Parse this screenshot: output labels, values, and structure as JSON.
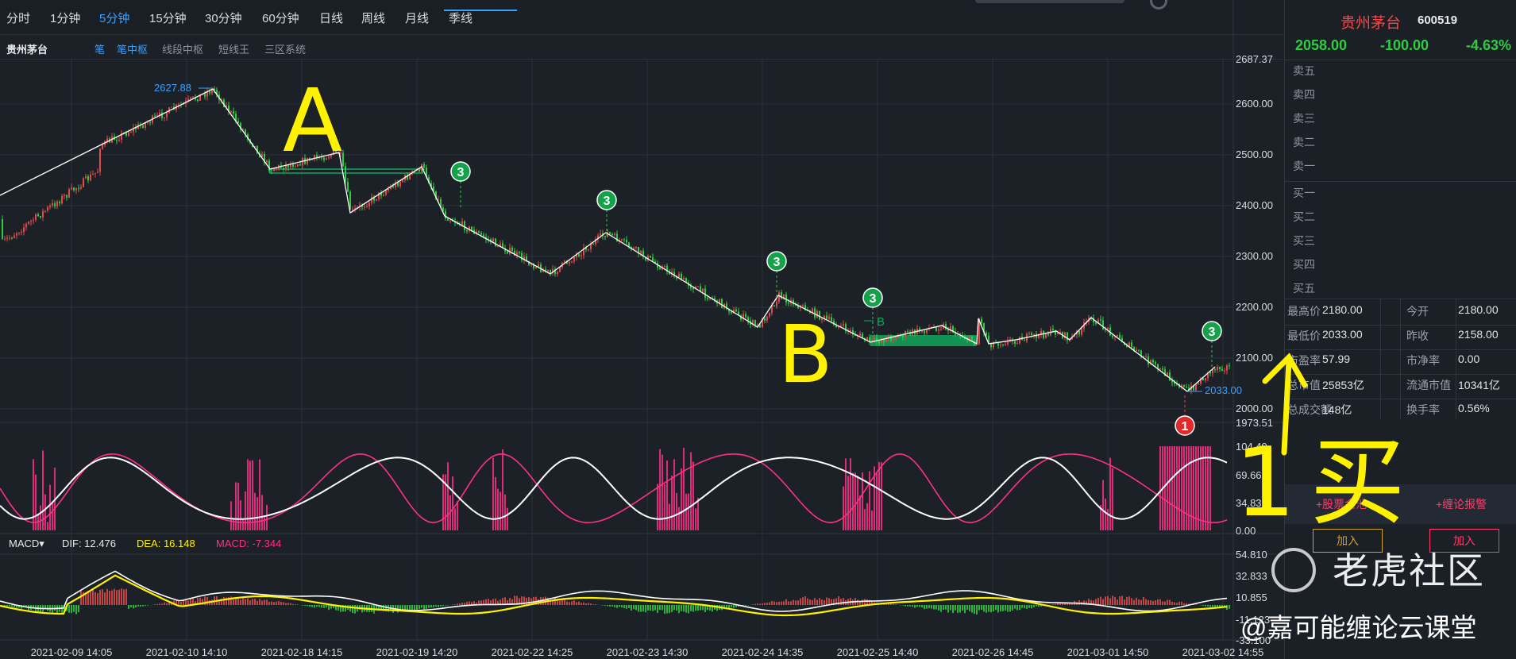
{
  "tabs": [
    "分时",
    "1分钟",
    "5分钟",
    "15分钟",
    "30分钟",
    "60分钟",
    "日线",
    "周线",
    "月线",
    "季线"
  ],
  "active_tab": "5分钟",
  "sub": {
    "title": "贵州茅台",
    "items": [
      "笔",
      "笔中枢",
      "线段中枢",
      "短线王",
      "三区系统"
    ]
  },
  "price_axis": [
    "2687.37",
    "2600.00",
    "2500.00",
    "2400.00",
    "2300.00",
    "2200.00",
    "2100.00",
    "2000.00",
    "1973.51"
  ],
  "osc_axis": [
    "104.49",
    "69.66",
    "34.83",
    "0.00"
  ],
  "macd_axis": [
    "54.810",
    "32.833",
    "10.855",
    "-11.123",
    "-33.100"
  ],
  "macd_labels": {
    "name": "MACD",
    "dif_label": "DIF: 12.476",
    "dea_label": "DEA: 16.148",
    "macd_label": "MACD: -7.344"
  },
  "time_labels": [
    "2021-02-09 14:05",
    "2021-02-10 14:10",
    "2021-02-18 14:15",
    "2021-02-19 14:20",
    "2021-02-22 14:25",
    "2021-02-23 14:30",
    "2021-02-24 14:35",
    "2021-02-25 14:40",
    "2021-02-26 14:45",
    "2021-03-01 14:50",
    "2021-03-02 14:55"
  ],
  "annotations": {
    "high": "2627.88",
    "low": "2033.00",
    "buy3": "3",
    "buy1": "1",
    "zs_label": "B"
  },
  "handwriting": {
    "a": "A",
    "b": "B",
    "buy_text": "1 买"
  },
  "quote": {
    "name": "贵州茅台",
    "code": "600519",
    "price": "2058.00",
    "change": "-100.00",
    "pct": "-4.63%"
  },
  "order_book": {
    "sell": [
      "卖五",
      "卖四",
      "卖三",
      "卖二",
      "卖一"
    ],
    "buy": [
      "买一",
      "买二",
      "买三",
      "买四",
      "买五"
    ]
  },
  "stats": [
    {
      "label": "最高价",
      "value": "2180.00",
      "label2": "今开",
      "value2": "2180.00"
    },
    {
      "label": "最低价",
      "value": "2033.00",
      "label2": "昨收",
      "value2": "2158.00"
    },
    {
      "label": "市盈率",
      "value": "57.99",
      "label2": "市净率",
      "value2": "0.00"
    },
    {
      "label": "总市值",
      "value": "25853亿",
      "label2": "流通市值",
      "value2": "10341亿"
    },
    {
      "label": "总成交额",
      "value": "148亿",
      "label2": "换手率",
      "value2": "0.56%"
    }
  ],
  "panel_buttons": {
    "pool": "+股票金池",
    "alert": "+缠论报警",
    "add": "加入"
  },
  "watermark": "老虎社区",
  "credit": "@嘉可能缠论云课堂",
  "colors": {
    "up": "#e04a4a",
    "down": "#2ecc40",
    "stroke": "#ffffff",
    "accent": "#3aa0ff",
    "pink": "#ff2f88",
    "yellow": "#fff200",
    "zhongshu": "#0fa65a"
  },
  "chart_data": {
    "type": "candlestick",
    "title": "贵州茅台",
    "ylim": [
      1973.51,
      2687.37
    ],
    "bi_line": [
      [
        "2021-02-09 14:05",
        2460
      ],
      [
        "2021-02-10 14:55",
        2630
      ],
      [
        "2021-02-18 10:00",
        2465
      ],
      [
        "2021-02-18 11:00",
        2515
      ],
      [
        "2021-02-18 14:00",
        2382
      ],
      [
        "2021-02-19 10:00",
        2480
      ],
      [
        "2021-02-19 11:30",
        2385
      ],
      [
        "2021-02-22 14:25",
        2268
      ],
      [
        "2021-02-23 10:30",
        2343
      ],
      [
        "2021-02-24 10:00",
        2168
      ],
      [
        "2021-02-24 11:00",
        2225
      ],
      [
        "2021-02-25 10:00",
        2115
      ],
      [
        "2021-02-25 14:00",
        2140
      ],
      [
        "2021-02-26 10:00",
        2100
      ],
      [
        "2021-02-26 11:00",
        2180
      ],
      [
        "2021-03-02 10:00",
        2033
      ],
      [
        "2021-03-02 14:00",
        2082
      ]
    ],
    "high": 2627.88,
    "low": 2033.0,
    "signals": [
      {
        "type": "3rd-buy/sell",
        "label": "3"
      },
      {
        "type": "1st-buy",
        "label": "1"
      }
    ]
  }
}
